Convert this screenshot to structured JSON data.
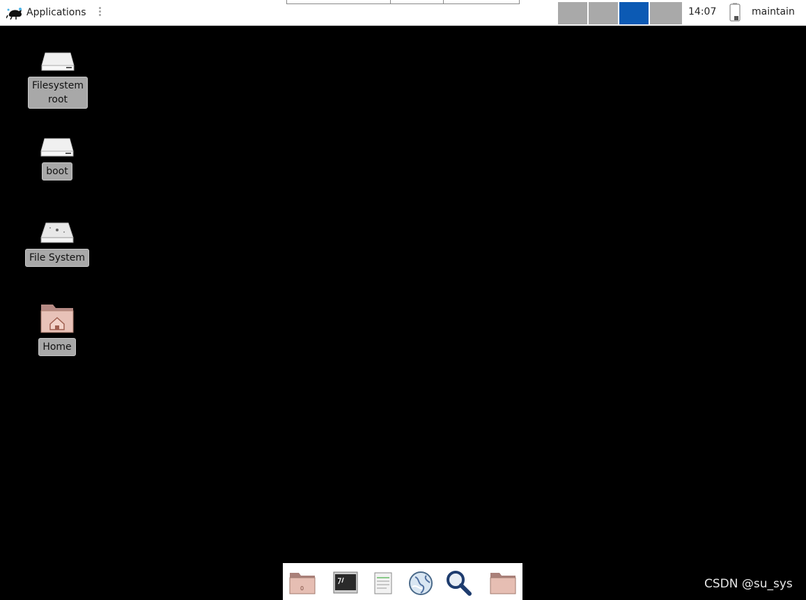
{
  "top_panel": {
    "applications_label": "Applications",
    "applications_icon": "mouse-logo-icon",
    "workspaces": [
      {
        "name": "workspace-1",
        "active": false
      },
      {
        "name": "workspace-2",
        "active": false
      },
      {
        "name": "workspace-3",
        "active": true
      },
      {
        "name": "workspace-4",
        "active": false
      }
    ],
    "clock": "14:07",
    "user": "maintain",
    "colors": {
      "active_workspace": "#0c5ab4",
      "inactive_workspace": "#a9a9a9"
    }
  },
  "desktop": {
    "icons": [
      {
        "label_line1": "Filesystem",
        "label_line2": "root",
        "icon": "drive-icon"
      },
      {
        "label": "boot",
        "icon": "drive-icon"
      },
      {
        "label": "File System",
        "icon": "removable-drive-icon"
      },
      {
        "label": "Home",
        "icon": "home-folder-icon"
      }
    ]
  },
  "dock": {
    "items": [
      "folder-icon",
      "terminal-icon",
      "text-editor-icon",
      "web-browser-icon",
      "search-icon",
      "folder-icon"
    ]
  },
  "watermark": "CSDN @su_sys"
}
